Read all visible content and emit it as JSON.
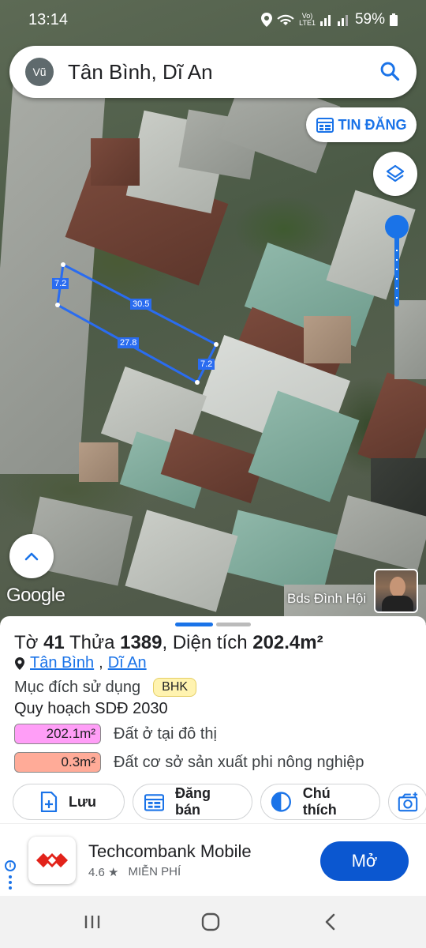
{
  "status_bar": {
    "time": "13:14",
    "volte": "Vo)\nLTE1",
    "battery": "59%"
  },
  "search": {
    "avatar": "Vũ",
    "query": "Tân Bình, Dĩ An"
  },
  "map": {
    "tin_dang_label": "TIN ĐĂNG",
    "google_label": "Google",
    "attribution": "Bds Đình Hội",
    "parcel_labels": [
      "7.2",
      "30.5",
      "27.8",
      "7.2"
    ]
  },
  "sheet": {
    "title_to_label": "Tờ",
    "title_to_value": "41",
    "title_thua_label": "Thửa",
    "title_thua_value": "1389",
    "title_dt_label": ", Diện tích",
    "title_dt_value": "202.4m²",
    "ward": "Tân Bình",
    "city": "Dĩ An",
    "purpose_label": "Mục đích sử dụng",
    "purpose_code": "BHK",
    "plan_label": "Quy hoạch SDĐ 2030",
    "zones": [
      {
        "area": "202.1m²",
        "desc": "Đất ở tại đô thị",
        "color": "#ff9ef7"
      },
      {
        "area": "0.3m²",
        "desc": "Đất cơ sở sản xuất phi nông nghiệp",
        "color": "#ffab98"
      }
    ],
    "actions": {
      "save": "Lưu",
      "post": "Đăng bán",
      "legend": "Chú thích"
    }
  },
  "ad": {
    "app_name": "Techcombank Mobile",
    "rating": "4.6",
    "price": "MIỄN PHÍ",
    "open_label": "Mở"
  },
  "colors": {
    "accent": "#1a73e8",
    "parcel_line": "#2a6cf0"
  }
}
